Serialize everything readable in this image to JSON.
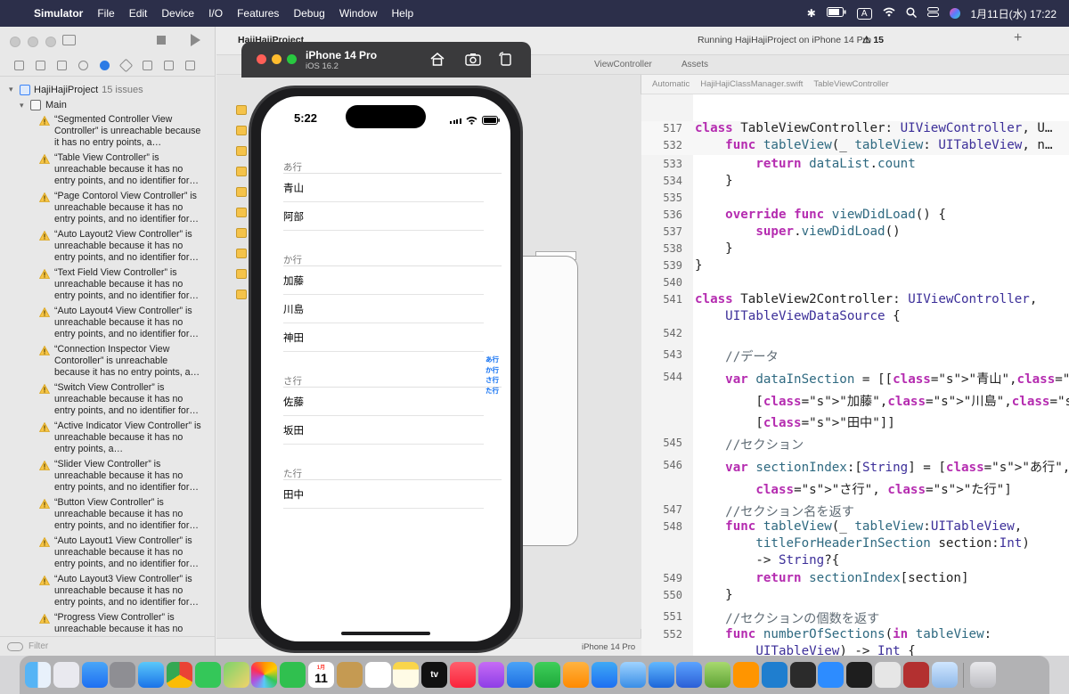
{
  "menubar": {
    "app": "Simulator",
    "items": [
      "File",
      "Edit",
      "Device",
      "I/O",
      "Features",
      "Debug",
      "Window",
      "Help"
    ],
    "datetime": "1月11日(水)  17:22",
    "input_source": "A"
  },
  "xcode": {
    "project_tab": "HajiHajiProject",
    "run_status": "Running HajiHajiProject on iPhone 14 Pro",
    "warning_count": "15",
    "tab_view_controller": "ViewController",
    "tab_assets": "Assets",
    "jumpbar": [
      "Automatic",
      "HajiHajiClassManager.swift",
      "TableViewController"
    ],
    "canvas_device": "iPhone 14 Pro",
    "filter_placeholder": "Filter"
  },
  "navigator": {
    "project_name": "HajiHajiProject",
    "issue_count": "15 issues",
    "group": "Main",
    "issues": [
      "“Segmented Controller View Controller” is unreachable because it has no entry points, a…",
      "“Table View Controller” is unreachable because it has no entry points, and no identifier for…",
      "“Page Contorol View Controller” is unreachable because it has no entry points, and no identifier for…",
      "“Auto Layout2 View Controller” is unreachable because it has no entry points, and no identifier for…",
      "“Text Field View Controller” is unreachable because it has no entry points, and no identifier for…",
      "“Auto Layout4 View Controller” is unreachable because it has no entry points, and no identifier for…",
      "“Connection Inspector View Contoroller” is unreachable because it has no entry points, a…",
      "“Switch View Controller” is unreachable because it has no entry points, and no identifier for…",
      "“Active Indicator View Controller” is unreachable because it has no entry points, a…",
      "“Slider View Controller” is unreachable because it has no entry points, and no identifier for…",
      "“Button View Controller” is unreachable because it has no entry points, and no identifier for…",
      "“Auto Layout1 View Controller” is unreachable because it has no entry points, and no identifier for…",
      "“Auto Layout3 View Controller” is unreachable because it has no entry points, and no identifier for…",
      "“Progress View Controller” is unreachable because it has no"
    ]
  },
  "simulator": {
    "device": "iPhone 14 Pro",
    "os": "iOS 16.2",
    "time": "5:22",
    "sections": [
      {
        "header": "あ行",
        "rows": [
          "青山",
          "阿部"
        ]
      },
      {
        "header": "か行",
        "rows": [
          "加藤",
          "川島",
          "神田"
        ]
      },
      {
        "header": "さ行",
        "rows": [
          "佐藤",
          "坂田"
        ]
      },
      {
        "header": "た行",
        "rows": [
          "田中"
        ]
      }
    ],
    "index": [
      "あ行",
      "か行",
      "さ行",
      "た行"
    ]
  },
  "code": {
    "sticky1": {
      "ln": "517",
      "text": "class TableViewController: UIViewController, U…"
    },
    "sticky2": {
      "ln": "532",
      "text": "    func tableView(_ tableView: UITableView, n…"
    },
    "lines": [
      {
        "ln": "533",
        "text": "        return dataList.count"
      },
      {
        "ln": "534",
        "text": "    }"
      },
      {
        "ln": "535",
        "text": ""
      },
      {
        "ln": "536",
        "text": "    override func viewDidLoad() {"
      },
      {
        "ln": "537",
        "text": "        super.viewDidLoad()"
      },
      {
        "ln": "538",
        "text": "    }"
      },
      {
        "ln": "539",
        "text": "}"
      },
      {
        "ln": "540",
        "text": ""
      },
      {
        "ln": "541",
        "text": "class TableView2Controller: UIViewController,"
      },
      {
        "ln": "",
        "text": "    UITableViewDataSource {"
      },
      {
        "ln": "542",
        "text": ""
      },
      {
        "ln": "543",
        "text": "    //データ"
      },
      {
        "ln": "544",
        "text": "    var dataInSection = [[\"青山\",\"阿部\"],"
      },
      {
        "ln": "",
        "text": "        [\"加藤\",\"川島\",\"神田\"], [\"佐藤\",\"坂田\"],"
      },
      {
        "ln": "",
        "text": "        [\"田中\"]]"
      },
      {
        "ln": "545",
        "text": "    //セクション"
      },
      {
        "ln": "546",
        "text": "    var sectionIndex:[String] = [\"あ行\", \"か行\","
      },
      {
        "ln": "",
        "text": "        \"さ行\", \"た行\"]"
      },
      {
        "ln": "547",
        "text": "    //セクション名を返す"
      },
      {
        "ln": "548",
        "text": "    func tableView(_ tableView:UITableView,"
      },
      {
        "ln": "",
        "text": "        titleForHeaderInSection section:Int)"
      },
      {
        "ln": "",
        "text": "        -> String?{"
      },
      {
        "ln": "549",
        "text": "        return sectionIndex[section]"
      },
      {
        "ln": "550",
        "text": "    }"
      },
      {
        "ln": "551",
        "text": "    //セクションの個数を返す"
      },
      {
        "ln": "552",
        "text": "    func numberOfSections(in tableView:"
      },
      {
        "ln": "",
        "text": "        UITableView) -> Int {"
      }
    ]
  },
  "dock": {
    "apps": [
      "finder-icon",
      "launchpad-icon",
      "mail-icon",
      "system-settings-icon",
      "safari-icon",
      "chrome-icon",
      "messages-icon",
      "maps-icon",
      "photos-icon",
      "facetime-icon",
      "calendar-icon",
      "notes-app-icon",
      "reminders-icon",
      "notes-icon",
      "apple-tv-icon",
      "music-icon",
      "podcasts-icon",
      "keynote-icon",
      "numbers-icon",
      "pages-icon",
      "app-store-icon",
      "preview-icon",
      "xcode-icon",
      "instruments-icon",
      "script-editor-icon",
      "books-icon",
      "vscode-icon",
      "simulator-icon",
      "zoom-icon",
      "terminal-icon",
      "font-book-icon",
      "dictionary-icon",
      "screenshot-icon",
      "trash-icon"
    ],
    "calendar_month": "1月",
    "calendar_day": "11",
    "tv_label": "tv"
  }
}
